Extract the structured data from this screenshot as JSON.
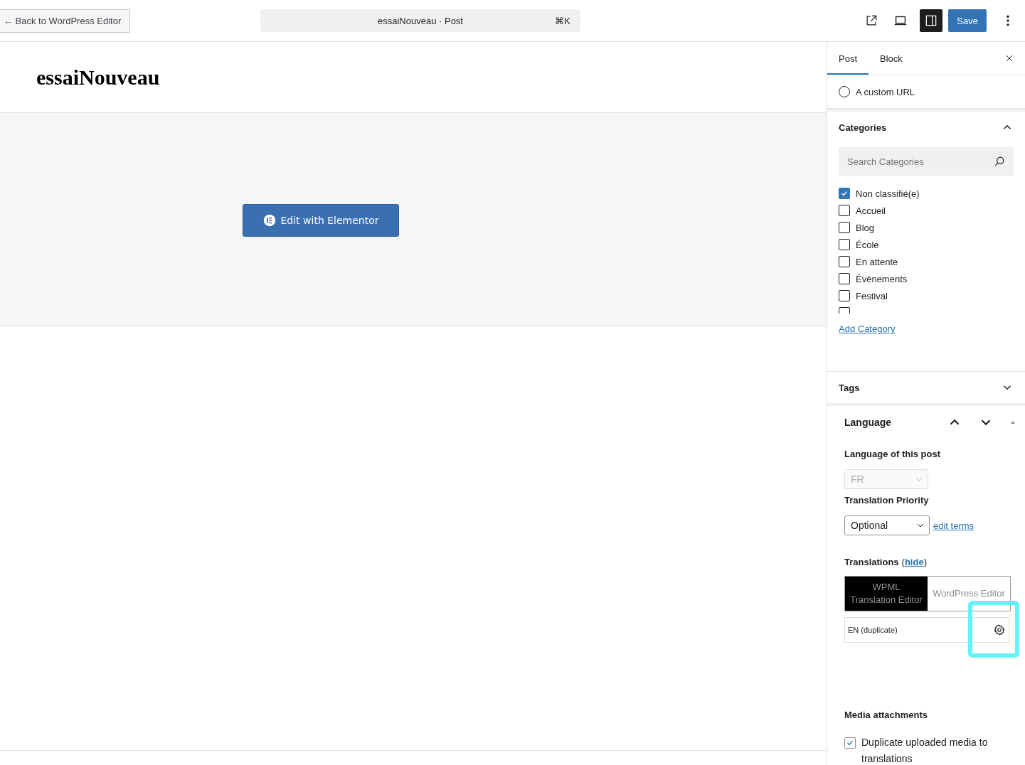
{
  "topbar": {
    "back_label": "← Back to WordPress Editor",
    "command": {
      "title": "essaiNouveau · Post",
      "shortcut": "⌘K"
    },
    "settings_toggle": {
      "selected": true
    },
    "save_label": "Save"
  },
  "canvas": {
    "title": "essaiNouveau",
    "elementor_button": "Edit with Elementor"
  },
  "sidebar": {
    "tabs": [
      {
        "label": "Post",
        "selected": true
      },
      {
        "label": "Block",
        "selected": false
      }
    ],
    "custom_url": {
      "label": "A custom URL",
      "selected": false
    },
    "categories": {
      "title": "Categories",
      "expanded": true,
      "search": {
        "placeholder": "Search Categories"
      },
      "items": [
        {
          "label": "Non classifié(e)",
          "checked": true
        },
        {
          "label": "Accueil",
          "checked": false
        },
        {
          "label": "Blog",
          "checked": false
        },
        {
          "label": "École",
          "checked": false
        },
        {
          "label": "En attente",
          "checked": false
        },
        {
          "label": "Évènements",
          "checked": false
        },
        {
          "label": "Festival",
          "checked": false
        },
        {
          "checked": false
        }
      ],
      "add_link": "Add Category"
    },
    "tags": {
      "title": "Tags",
      "expanded": false
    },
    "language": {
      "title": "Language",
      "language_label": "Language of this post",
      "language_value": "FR",
      "priority_label": "Translation Priority",
      "priority_value": "Optional",
      "edit_terms": "edit terms",
      "translations_label": "Translations",
      "open_paren": "(",
      "hide_link": "hide",
      "close_paren": ")",
      "editor_tabs": [
        {
          "label": "WPML Translation Editor",
          "selected": true
        },
        {
          "label": "WordPress Editor",
          "selected": false
        }
      ],
      "translation_rows": [
        {
          "label": "EN (duplicate)",
          "highlighted": true
        }
      ],
      "media_label": "Media attachments",
      "media_option": {
        "label": "Duplicate uploaded media to translations",
        "checked": true
      }
    }
  }
}
